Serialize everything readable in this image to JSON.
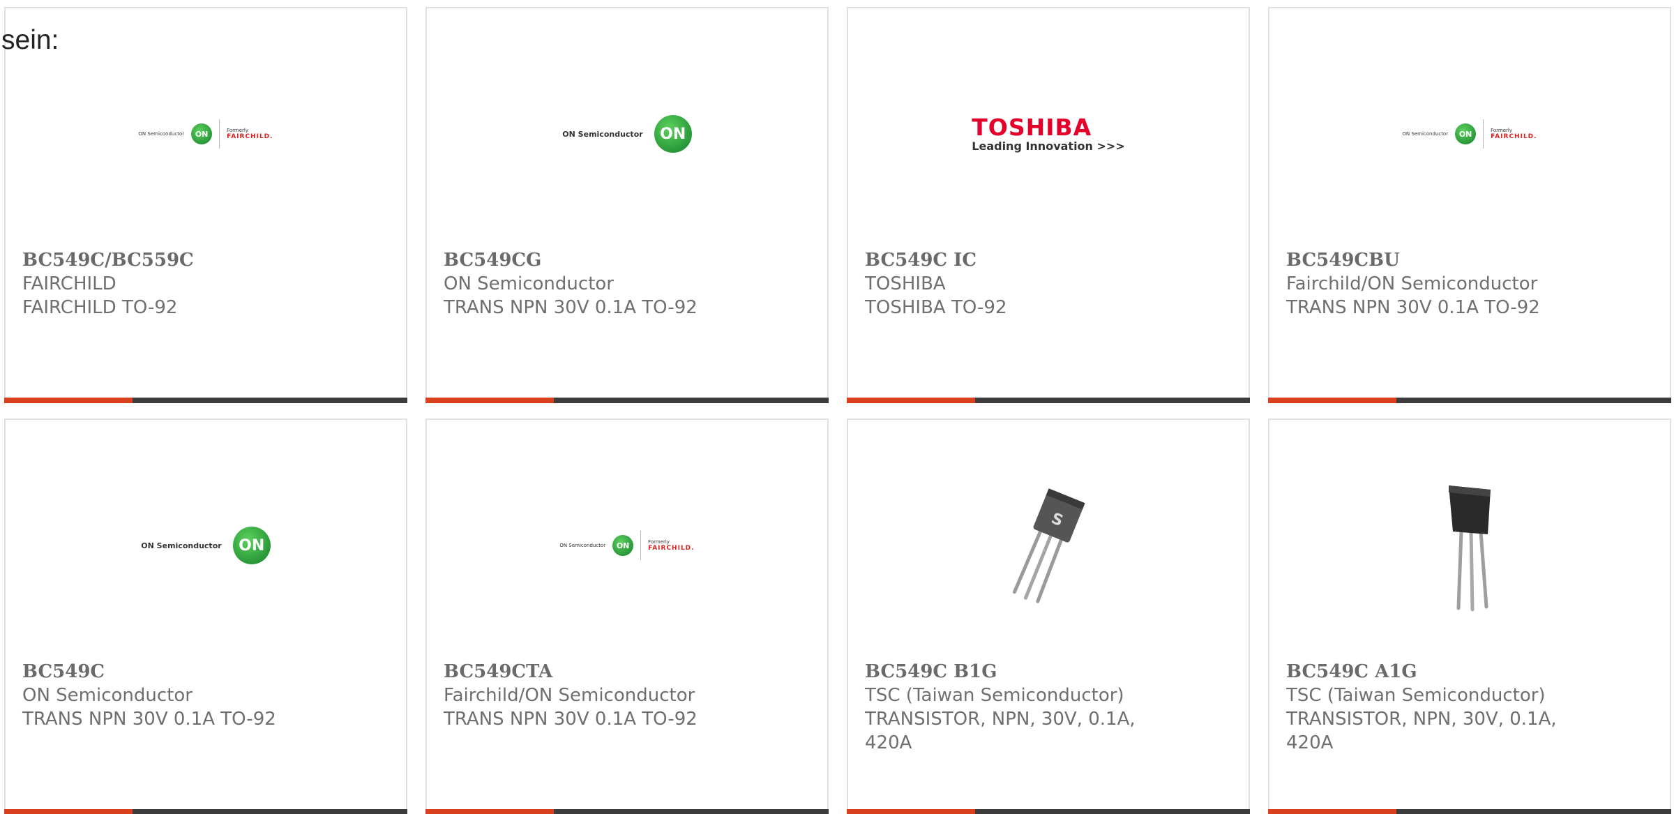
{
  "intro_text": "sein:",
  "colors": {
    "accent_bar": "#d9411e",
    "dark_bar": "#3c3c3c",
    "on_green": "#1c9e3a",
    "fairchild_red": "#d9211e",
    "toshiba_red": "#e4002b",
    "card_text": "#6f6f6f"
  },
  "logo_text": {
    "on_semi_small": "ON Semiconductor",
    "on_semi": "ON Semiconductor",
    "on_badge": "ON",
    "formerly": "Formerly",
    "fairchild": "FAIRCHILD.",
    "toshiba": "TOSHIBA",
    "toshiba_tag": "Leading Innovation >>>"
  },
  "cards": [
    {
      "part": "BC549C/BC559C",
      "manufacturer": "FAIRCHILD",
      "description": "FAIRCHILD TO-92",
      "image": "on-fairchild-logo"
    },
    {
      "part": "BC549CG",
      "manufacturer": "ON Semiconductor",
      "description": "TRANS NPN 30V 0.1A TO-92",
      "image": "on-semiconductor-logo"
    },
    {
      "part": "BC549C IC",
      "manufacturer": "TOSHIBA",
      "description": "TOSHIBA TO-92",
      "image": "toshiba-logo"
    },
    {
      "part": "BC549CBU",
      "manufacturer": "Fairchild/ON Semiconductor",
      "description": "TRANS NPN 30V 0.1A TO-92",
      "image": "on-fairchild-logo"
    },
    {
      "part": "BC549C",
      "manufacturer": "ON Semiconductor",
      "description": "TRANS NPN 30V 0.1A TO-92",
      "image": "on-semiconductor-logo"
    },
    {
      "part": "BC549CTA",
      "manufacturer": "Fairchild/ON Semiconductor",
      "description": "TRANS NPN 30V 0.1A TO-92",
      "image": "on-fairchild-logo"
    },
    {
      "part": "BC549C B1G",
      "manufacturer": "TSC (Taiwan Semiconductor)",
      "description": "TRANSISTOR, NPN, 30V, 0.1A, 420A",
      "image": "to92-transistor-tilted"
    },
    {
      "part": "BC549C A1G",
      "manufacturer": "TSC (Taiwan Semiconductor)",
      "description": "TRANSISTOR, NPN, 30V, 0.1A, 420A",
      "image": "to92-transistor-front"
    }
  ]
}
